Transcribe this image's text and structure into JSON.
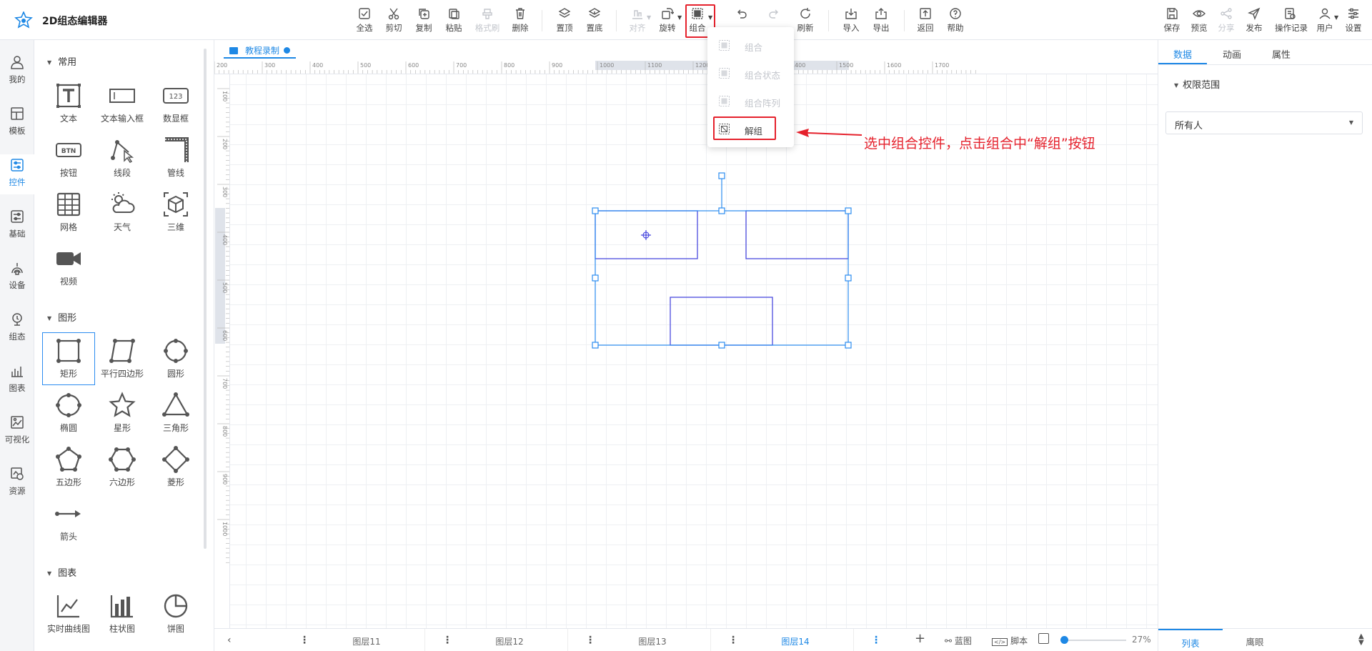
{
  "app": {
    "title": "2D组态编辑器"
  },
  "toolbar": {
    "select_all": "全选",
    "cut": "剪切",
    "copy": "复制",
    "paste": "粘贴",
    "format_brush": "格式刷",
    "delete": "删除",
    "bring_top": "置顶",
    "send_bottom": "置底",
    "align": "对齐",
    "rotate": "旋转",
    "group": "组合",
    "refresh": "刷新",
    "import": "导入",
    "export": "导出",
    "back": "返回",
    "help": "帮助",
    "save": "保存",
    "preview": "预览",
    "share": "分享",
    "publish": "发布",
    "history": "操作记录",
    "user": "用户",
    "settings": "设置"
  },
  "leftnav": {
    "items": [
      {
        "label": "我的",
        "icon": "user-icon"
      },
      {
        "label": "模板",
        "icon": "template-icon"
      },
      {
        "label": "控件",
        "icon": "controls-icon",
        "active": true
      },
      {
        "label": "基础",
        "icon": "basic-icon"
      },
      {
        "label": "设备",
        "icon": "device-icon"
      },
      {
        "label": "组态",
        "icon": "scada-icon"
      },
      {
        "label": "图表",
        "icon": "chart-icon"
      },
      {
        "label": "可视化",
        "icon": "visual-icon"
      },
      {
        "label": "资源",
        "icon": "resource-icon"
      }
    ]
  },
  "panel": {
    "sections": {
      "common": "常用",
      "shapes": "图形",
      "charts": "图表"
    },
    "common_items": [
      "文本",
      "文本输入框",
      "数显框",
      "按钮",
      "线段",
      "管线",
      "网格",
      "天气",
      "三维",
      "视频"
    ],
    "shape_items": [
      "矩形",
      "平行四边形",
      "圆形",
      "椭圆",
      "星形",
      "三角形",
      "五边形",
      "六边形",
      "菱形",
      "箭头"
    ],
    "chart_items": [
      "实时曲线图",
      "柱状图",
      "饼图"
    ]
  },
  "canvas": {
    "tab_label": "教程录制",
    "ruler_top": [
      "200",
      "300",
      "400",
      "500",
      "600",
      "700",
      "800",
      "900",
      "1000",
      "1100",
      "1200",
      "1300",
      "1400",
      "1500",
      "1600",
      "1700"
    ],
    "ruler_left": [
      "100",
      "200",
      "300",
      "400",
      "500",
      "600",
      "700",
      "800",
      "900",
      "1000"
    ]
  },
  "group_menu": {
    "items": [
      {
        "label": "组合",
        "enabled": false
      },
      {
        "label": "组合状态",
        "enabled": false
      },
      {
        "label": "组合阵列",
        "enabled": false
      },
      {
        "label": "解组",
        "enabled": true
      }
    ]
  },
  "annotation": {
    "text": "选中组合控件，点击组合中“解组”按钮"
  },
  "layers": {
    "tabs": [
      "图层11",
      "图层12",
      "图层13",
      "图层14"
    ],
    "active": "图层14",
    "tools": {
      "blueprint": "蓝图",
      "script": "脚本",
      "zoom": "27%"
    }
  },
  "rightpanel": {
    "tabs": [
      "数据",
      "动画",
      "属性"
    ],
    "permission_title": "权限范围",
    "permission_value": "所有人",
    "bottom_tabs": [
      "列表",
      "鹰眼"
    ]
  },
  "colors": {
    "accent": "#1e88e5",
    "annotation": "#e5212c",
    "shape_stroke": "#4a4adf"
  }
}
